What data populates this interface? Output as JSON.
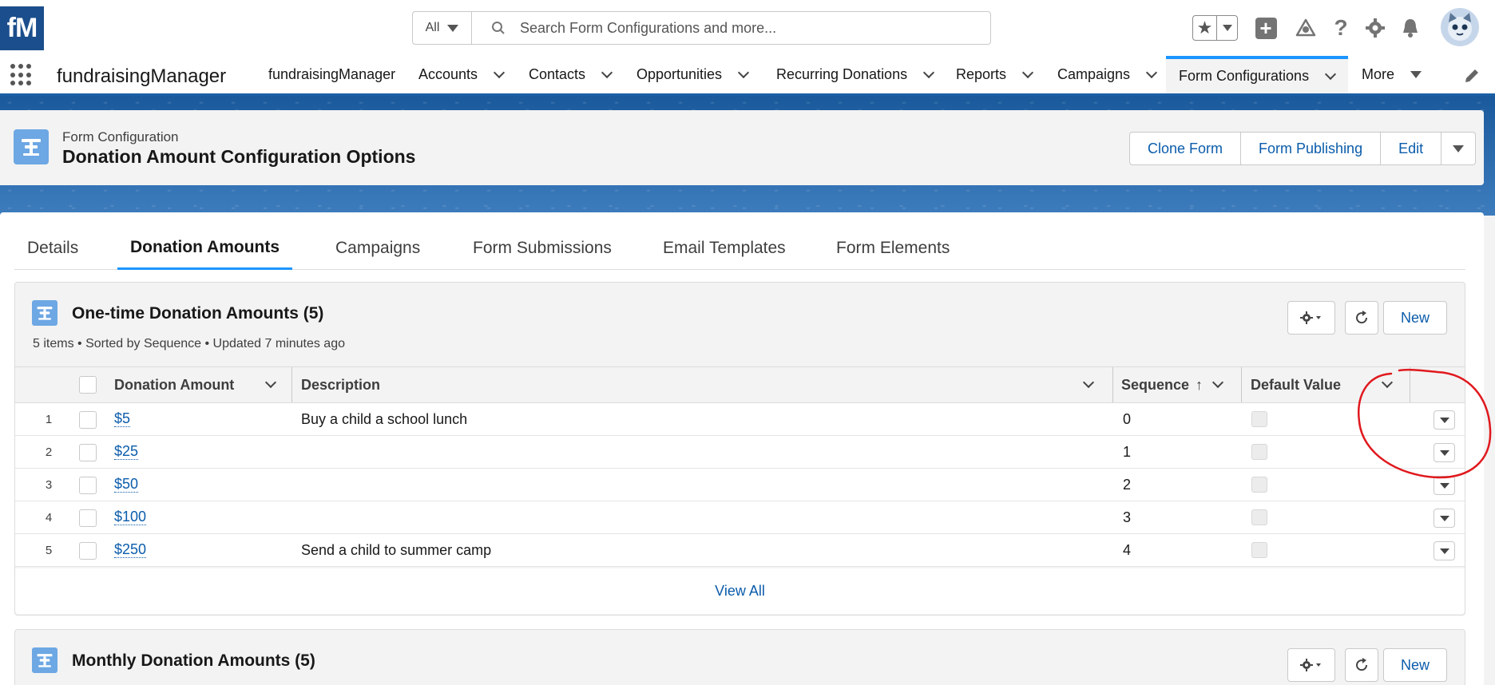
{
  "header": {
    "logo_text": "fM",
    "search_scope": "All",
    "search_placeholder": "Search Form Configurations and more...",
    "icons": [
      "favorites-star-icon",
      "add-icon",
      "trailhead-icon",
      "help-icon",
      "setup-gear-icon",
      "notifications-bell-icon",
      "user-avatar"
    ]
  },
  "nav": {
    "app_name": "fundraisingManager",
    "items": [
      {
        "label": "fundraisingManager",
        "has_menu": false
      },
      {
        "label": "Accounts",
        "has_menu": true
      },
      {
        "label": "Contacts",
        "has_menu": true
      },
      {
        "label": "Opportunities",
        "has_menu": true
      },
      {
        "label": "Recurring Donations",
        "has_menu": true
      },
      {
        "label": "Reports",
        "has_menu": true
      },
      {
        "label": "Campaigns",
        "has_menu": true
      },
      {
        "label": "Form Configurations",
        "has_menu": true,
        "active": true
      },
      {
        "label": "More",
        "has_menu": true
      }
    ]
  },
  "record": {
    "object_type": "Form Configuration",
    "title": "Donation Amount Configuration Options",
    "actions": [
      "Clone Form",
      "Form Publishing",
      "Edit"
    ]
  },
  "tabs": [
    "Details",
    "Donation Amounts",
    "Campaigns",
    "Form Submissions",
    "Email Templates",
    "Form Elements"
  ],
  "active_tab": "Donation Amounts",
  "one_time": {
    "title": "One-time Donation Amounts (5)",
    "meta": "5 items • Sorted by Sequence • Updated 7 minutes ago",
    "new_label": "New",
    "columns": {
      "amount": "Donation Amount",
      "description": "Description",
      "sequence": "Sequence",
      "sort_arrow": "↑",
      "default": "Default Value"
    },
    "rows": [
      {
        "num": "1",
        "amount": "$5",
        "description": "Buy a child a school lunch",
        "sequence": "0"
      },
      {
        "num": "2",
        "amount": "$25",
        "description": "",
        "sequence": "1"
      },
      {
        "num": "3",
        "amount": "$50",
        "description": "",
        "sequence": "2"
      },
      {
        "num": "4",
        "amount": "$100",
        "description": "",
        "sequence": "3"
      },
      {
        "num": "5",
        "amount": "$250",
        "description": "Send a child to summer camp",
        "sequence": "4"
      }
    ],
    "view_all": "View All"
  },
  "monthly": {
    "title": "Monthly Donation Amounts (5)",
    "new_label": "New"
  },
  "colors": {
    "brand_blue": "#0b5cab",
    "accent_blue": "#1b96ff",
    "banner_blue": "#1f5fa0",
    "object_icon": "#6da7e4",
    "annotation_red": "#e0191e"
  }
}
